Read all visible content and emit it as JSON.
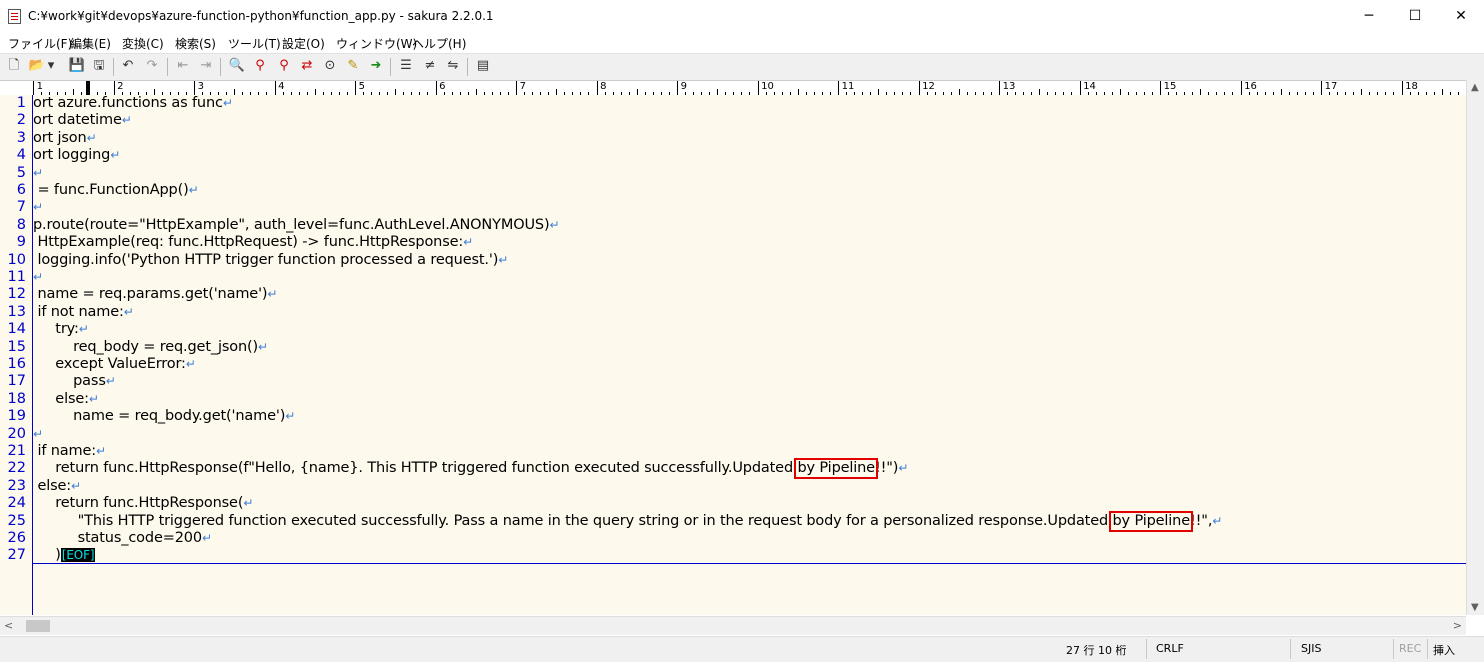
{
  "window": {
    "title": "C:¥work¥git¥devops¥azure-function-python¥function_app.py - sakura 2.2.0.1",
    "minimize_glyph": "─",
    "maximize_glyph": "☐",
    "close_glyph": "✕"
  },
  "menu": [
    {
      "label": "ファイル(F)"
    },
    {
      "label": "編集(E)"
    },
    {
      "label": "変換(C)"
    },
    {
      "label": "検索(S)"
    },
    {
      "label": "ツール(T)"
    },
    {
      "label": "設定(O)"
    },
    {
      "label": "ウィンドウ(W)"
    },
    {
      "label": "ヘルプ(H)"
    }
  ],
  "toolbar": [
    {
      "icon": "new-file-icon",
      "glyph": "🗋"
    },
    {
      "icon": "open-folder-icon",
      "glyph": "📂"
    },
    {
      "icon": "dropdown-icon",
      "glyph": "▾"
    },
    {
      "icon": "save-icon",
      "glyph": "💾"
    },
    {
      "icon": "save-all-icon",
      "glyph": "🖫"
    },
    {
      "icon": "undo-icon",
      "glyph": "↶"
    },
    {
      "icon": "redo-icon",
      "glyph": "↷"
    },
    {
      "icon": "move-prev-icon",
      "glyph": "⇤"
    },
    {
      "icon": "move-next-icon",
      "glyph": "⇥"
    },
    {
      "icon": "search-icon",
      "glyph": "🔍"
    },
    {
      "icon": "search-next-icon",
      "glyph": "⚲"
    },
    {
      "icon": "search-prev-icon",
      "glyph": "⚲"
    },
    {
      "icon": "replace-icon",
      "glyph": "⇄"
    },
    {
      "icon": "grep-icon",
      "glyph": "⊙"
    },
    {
      "icon": "mark-icon",
      "glyph": "✎"
    },
    {
      "icon": "jump-icon",
      "glyph": "➜"
    },
    {
      "icon": "outline-icon",
      "glyph": "☰"
    },
    {
      "icon": "diff-icon",
      "glyph": "≠"
    },
    {
      "icon": "compare-icon",
      "glyph": "⇋"
    },
    {
      "icon": "settings-icon",
      "glyph": "▤"
    }
  ],
  "ruler": {
    "labels": [
      "1",
      "2",
      "3",
      "4",
      "5",
      "6",
      "7",
      "8",
      "9",
      "10",
      "11",
      "12",
      "13",
      "14",
      "15",
      "16",
      "17",
      "18"
    ]
  },
  "editor": {
    "lines": [
      {
        "no": "1",
        "text": "ort azure.functions as func",
        "crlf": true
      },
      {
        "no": "2",
        "text": "ort datetime",
        "crlf": true
      },
      {
        "no": "3",
        "text": "ort json",
        "crlf": true
      },
      {
        "no": "4",
        "text": "ort logging",
        "crlf": true
      },
      {
        "no": "5",
        "text": "",
        "crlf": true
      },
      {
        "no": "6",
        "text": " = func.FunctionApp()",
        "crlf": true
      },
      {
        "no": "7",
        "text": "",
        "crlf": true
      },
      {
        "no": "8",
        "text": "p.route(route=\"HttpExample\", auth_level=func.AuthLevel.ANONYMOUS)",
        "crlf": true
      },
      {
        "no": "9",
        "text": " HttpExample(req: func.HttpRequest) -> func.HttpResponse:",
        "crlf": true
      },
      {
        "no": "10",
        "text": " logging.info('Python HTTP trigger function processed a request.')",
        "crlf": true
      },
      {
        "no": "11",
        "text": "",
        "crlf": true
      },
      {
        "no": "12",
        "text": " name = req.params.get('name')",
        "crlf": true
      },
      {
        "no": "13",
        "text": " if not name:",
        "crlf": true
      },
      {
        "no": "14",
        "text": "     try:",
        "crlf": true
      },
      {
        "no": "15",
        "text": "         req_body = req.get_json()",
        "crlf": true
      },
      {
        "no": "16",
        "text": "     except ValueError:",
        "crlf": true
      },
      {
        "no": "17",
        "text": "         pass",
        "crlf": true
      },
      {
        "no": "18",
        "text": "     else:",
        "crlf": true
      },
      {
        "no": "19",
        "text": "         name = req_body.get('name')",
        "crlf": true
      },
      {
        "no": "20",
        "text": "",
        "crlf": true
      },
      {
        "no": "21",
        "text": " if name:",
        "crlf": true
      },
      {
        "no": "22",
        "text": "     return func.HttpResponse(f\"Hello, {name}. This HTTP triggered function executed successfully.Updated by Pipeline!!\")",
        "crlf": true
      },
      {
        "no": "23",
        "text": " else:",
        "crlf": true
      },
      {
        "no": "24",
        "text": "     return func.HttpResponse(",
        "crlf": true
      },
      {
        "no": "25",
        "text": "          \"This HTTP triggered function executed successfully. Pass a name in the query string or in the request body for a personalized response.Updated by Pipeline!!\",",
        "crlf": true
      },
      {
        "no": "26",
        "text": "          status_code=200",
        "crlf": true
      },
      {
        "no": "27",
        "text": "     )",
        "crlf": false
      }
    ],
    "crlf_mark": "↵",
    "eof_mark": "[EOF]",
    "highlight_text": "by Pipeline",
    "colors": {
      "background": "#fdf9ec",
      "line_number": "#0000cc",
      "crlf": "#3f7fd6",
      "eof_fg": "#00e5e5",
      "highlight_box": "#e00000"
    }
  },
  "statusbar": {
    "position": "27 行  10 桁",
    "line_ending": "CRLF",
    "encoding": "SJIS",
    "rec": "REC",
    "mode": "挿入"
  }
}
